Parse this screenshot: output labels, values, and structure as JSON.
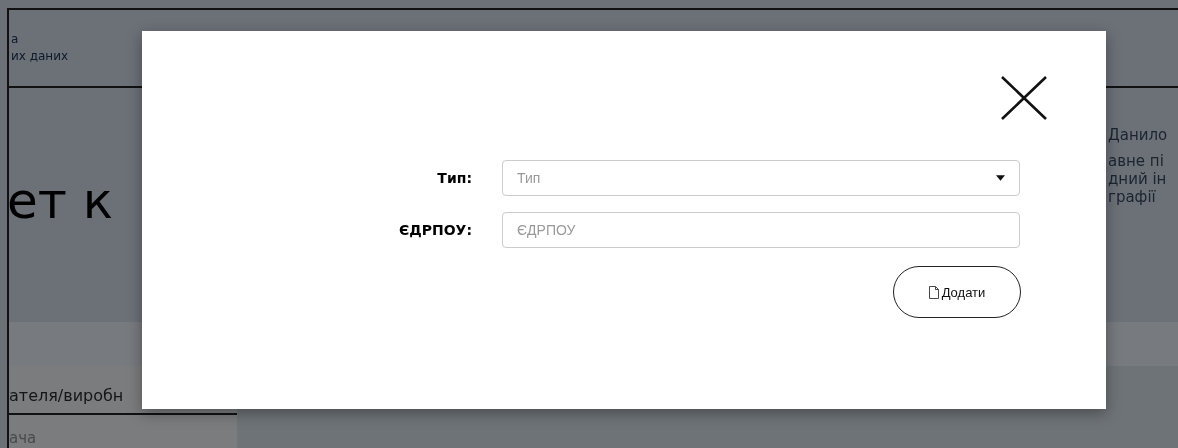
{
  "page": {
    "header_text": [
      "а",
      "их даних"
    ],
    "heading": "ет к",
    "side_name": "Данило",
    "side_lines": [
      "авне пі",
      "дний ін",
      "графії"
    ],
    "section_label": "ателя/виробн",
    "list_item": "ача"
  },
  "modal": {
    "fields": [
      {
        "kind": "select",
        "label": "Тип:",
        "placeholder": "Тип"
      },
      {
        "kind": "text",
        "label": "ЄДРПОУ:",
        "placeholder": "ЄДРПОУ"
      }
    ],
    "button": "Додати"
  }
}
